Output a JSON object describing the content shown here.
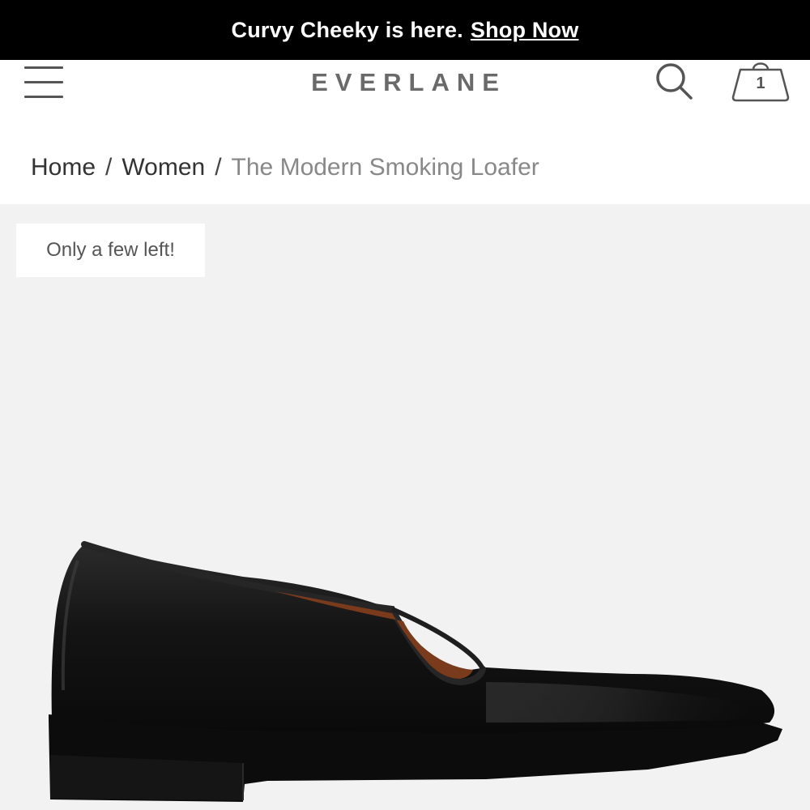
{
  "promo": {
    "text": "Curvy Cheeky is here.",
    "link_label": "Shop Now"
  },
  "header": {
    "logo": "EVERLANE",
    "icons": {
      "menu": "hamburger-menu-icon",
      "search": "search-icon",
      "cart": "shopping-bag-icon"
    },
    "cart_count": "1"
  },
  "breadcrumb": {
    "items": [
      "Home",
      "Women"
    ],
    "separator": "/",
    "current": "The Modern Smoking Loafer"
  },
  "product": {
    "badge": "Only a few left!",
    "image": "black-leather-loafer-image"
  },
  "colors": {
    "promo_bg": "#000000",
    "hero_bg": "#f2f2f2",
    "logo": "#6a6a6a"
  }
}
